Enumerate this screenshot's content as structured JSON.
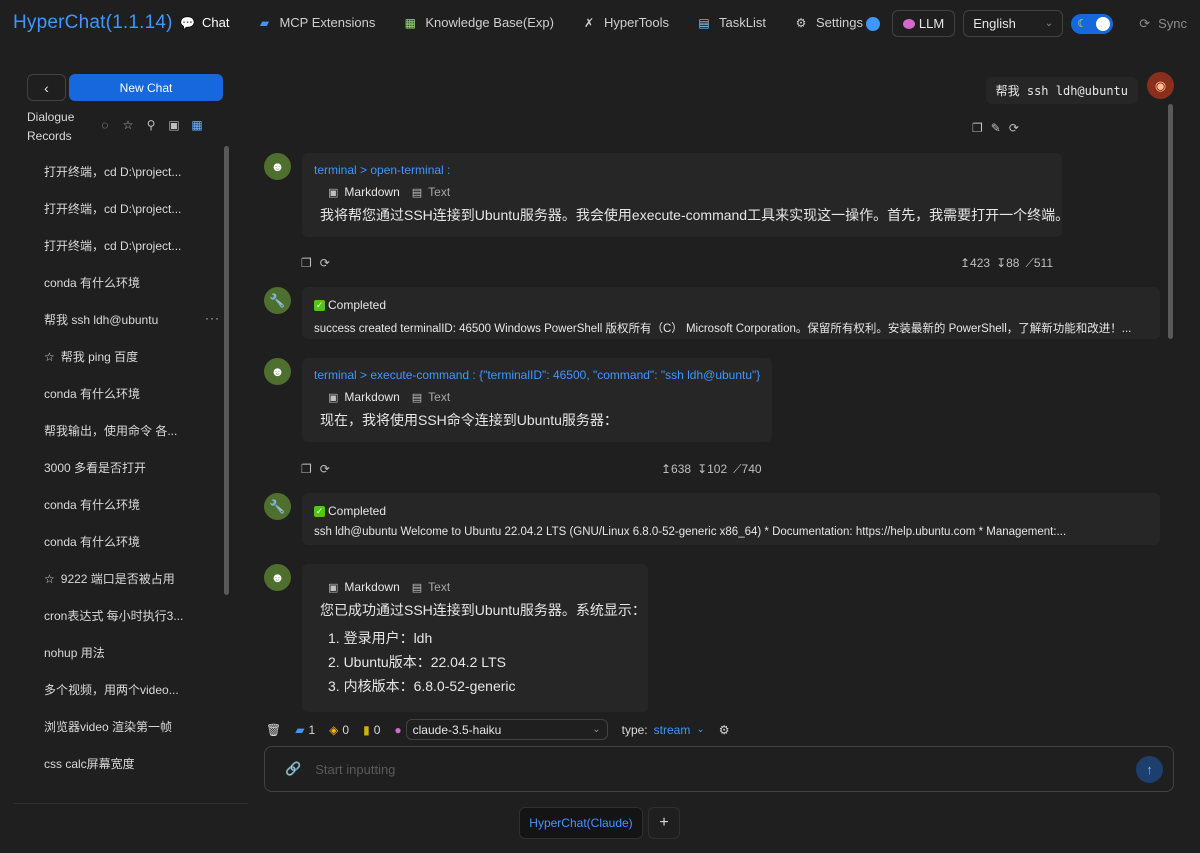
{
  "app": {
    "title": "HyperChat(1.1.14)"
  },
  "nav": [
    {
      "icon": "chat-icon",
      "glyph": "💬",
      "label": "Chat"
    },
    {
      "icon": "extensions-icon",
      "glyph": "▰",
      "label": "MCP Extensions"
    },
    {
      "icon": "knowledge-icon",
      "glyph": "▦",
      "label": "Knowledge Base(Exp)"
    },
    {
      "icon": "tools-icon",
      "glyph": "✗",
      "label": "HyperTools"
    },
    {
      "icon": "tasklist-icon",
      "glyph": "▤",
      "label": "TaskList"
    },
    {
      "icon": "settings-icon",
      "glyph": "⚙",
      "label": "Settings"
    }
  ],
  "header_right": {
    "llm_label": "LLM",
    "language": "English",
    "sync_label": "Sync"
  },
  "sidebar": {
    "new_chat_label": "New Chat",
    "records_label": "Dialogue Records",
    "items": [
      {
        "label": "打开终端，cd D:\\project...",
        "starred": false
      },
      {
        "label": "打开终端，cd D:\\project...",
        "starred": false
      },
      {
        "label": "打开终端，cd D:\\project...",
        "starred": false
      },
      {
        "label": "conda 有什么环境",
        "starred": false
      },
      {
        "label": "帮我 ssh ldh@ubuntu",
        "starred": false,
        "more": "···"
      },
      {
        "label": "帮我 ping 百度",
        "starred": true
      },
      {
        "label": "conda 有什么环境",
        "starred": false
      },
      {
        "label": "帮我输出，使用命令 各...",
        "starred": false
      },
      {
        "label": "3000 多看是否打开",
        "starred": false
      },
      {
        "label": "conda 有什么环境",
        "starred": false
      },
      {
        "label": "conda 有什么环境",
        "starred": false
      },
      {
        "label": "9222 端口是否被占用",
        "starred": true
      },
      {
        "label": "cron表达式 每小时执行3...",
        "starred": false
      },
      {
        "label": "nohup 用法",
        "starred": false
      },
      {
        "label": "多个视频，用两个video...",
        "starred": false
      },
      {
        "label": "浏览器video 渲染第一帧",
        "starred": false
      },
      {
        "label": "css calc屏幕宽度",
        "starred": false
      }
    ]
  },
  "chat": {
    "user_message": "帮我  ssh ldh@ubuntu",
    "msg1": {
      "tool": "terminal > open-terminal :",
      "tab_markdown": "Markdown",
      "tab_text": "Text",
      "text": "我将帮您通过SSH连接到Ubuntu服务器。我会使用execute-command工具来实现这一操作。首先，我需要打开一个终端。",
      "tokens": [
        "↥423",
        "↧88",
        "⟋511"
      ]
    },
    "tool1": {
      "status": "Completed",
      "result": "success created terminalID: 46500 Windows PowerShell 版权所有（C） Microsoft Corporation。保留所有权利。安装最新的 PowerShell，了解新功能和改进！..."
    },
    "msg2": {
      "tool": "terminal > execute-command : {\"terminalID\": 46500, \"command\": \"ssh ldh@ubuntu\"}",
      "tab_markdown": "Markdown",
      "tab_text": "Text",
      "text": "现在，我将使用SSH命令连接到Ubuntu服务器：",
      "tokens": [
        "↥638",
        "↧102",
        "⟋740"
      ]
    },
    "tool2": {
      "status": "Completed",
      "result": "ssh ldh@ubuntu Welcome to Ubuntu 22.04.2 LTS (GNU/Linux 6.8.0-52-generic x86_64) * Documentation: https://help.ubuntu.com * Management:..."
    },
    "msg3": {
      "tab_markdown": "Markdown",
      "tab_text": "Text",
      "text": "您已成功通过SSH连接到Ubuntu服务器。系统显示：",
      "list": [
        "1. 登录用户：ldh",
        "2. Ubuntu版本：22.04.2 LTS",
        "3. 内核版本：6.8.0-52-generic"
      ]
    }
  },
  "composer": {
    "counts": [
      "1",
      "0",
      "0"
    ],
    "model": "claude-3.5-haiku",
    "type_label": "type:",
    "type_value": "stream",
    "placeholder": "Start inputting"
  },
  "bottom_tabs": {
    "active": "HyperChat(Claude)",
    "add": "+"
  }
}
